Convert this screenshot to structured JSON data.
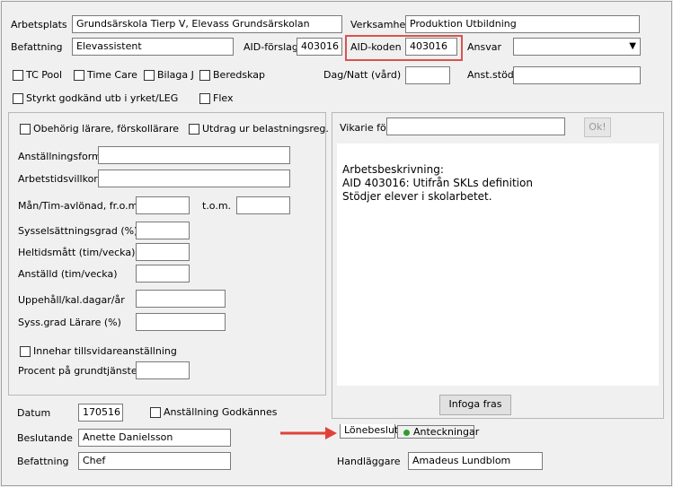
{
  "top": {
    "arbetsplats_label": "Arbetsplats",
    "arbetsplats_value": "Grundsärskola Tierp V, Elevass Grundsärskolan",
    "verksamhet_label": "Verksamhet",
    "verksamhet_value": "Produktion Utbildning",
    "befattning_label": "Befattning",
    "befattning_value": "Elevassistent",
    "aid_forslag_label": "AID-förslag",
    "aid_forslag_value": "403016",
    "aid_koden_label": "AID-koden",
    "aid_koden_value": "403016",
    "ansvar_label": "Ansvar",
    "ansvar_value": "",
    "dropdown_arrow": "▼",
    "dag_natt_label": "Dag/Natt (vård)",
    "anst_stod_label": "Anst.stöd"
  },
  "checkboxes": {
    "tc_pool": "TC Pool",
    "time_care": "Time Care",
    "bilaga_j": "Bilaga J",
    "beredskap": "Beredskap",
    "styrkt": "Styrkt godkänd utb i yrket/LEG",
    "flex": "Flex"
  },
  "left_panel": {
    "obehorig": "Obehörig lärare, förskollärare",
    "utdrag": "Utdrag ur belastningsreg.",
    "anstallningsform": "Anställningsform",
    "arbetstidsvillkor": "Arbetstidsvillkor",
    "man_tim": "Mån/Tim-avlönad, fr.o.m.",
    "tom": "t.o.m.",
    "sysselsattningsgrad": "Sysselsättningsgrad (%)",
    "heltidsmatt": "Heltidsmått (tim/vecka)",
    "anstalld": "Anställd (tim/vecka)",
    "uppehall": "Uppehåll/kal.dagar/år",
    "syss_grad_larare": "Syss.grad Lärare (%)",
    "innehar": "Innehar tillsvidareanställning",
    "procent": "Procent på grundtjänsten"
  },
  "right_panel": {
    "vikarie_label": "Vikarie för",
    "ok_button": "Ok!",
    "arbetsbeskrivning_line1": "Arbetsbeskrivning:",
    "arbetsbeskrivning_line2": "AID 403016: Utifrån SKLs definition",
    "arbetsbeskrivning_line3": "Stödjer elever i skolarbetet.",
    "infoga_button": "Infoga fras"
  },
  "bottom": {
    "datum_label": "Datum",
    "datum_value": "170516",
    "anst_godkannes": "Anställning Godkännes",
    "beslutande_label": "Beslutande",
    "beslutande_value": "Anette Danielsson",
    "befattning_label": "Befattning",
    "befattning_value": "Chef",
    "handlaggare_label": "Handläggare",
    "handlaggare_value": "Amadeus Lundblom",
    "tab_lonebeslut": "Lönebeslut",
    "tab_anteckningar": "Anteckningar"
  },
  "colors": {
    "highlight": "#d9534f",
    "arrow": "#e0423a",
    "tab_dot": "#2e9e2e"
  }
}
